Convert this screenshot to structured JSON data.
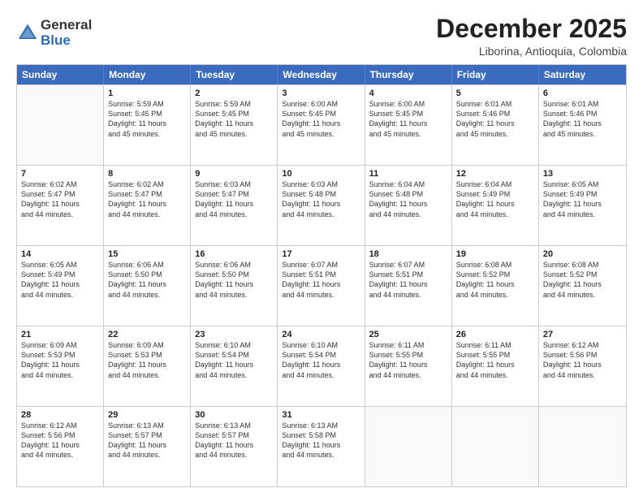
{
  "logo": {
    "general": "General",
    "blue": "Blue"
  },
  "title": "December 2025",
  "location": "Liborina, Antioquia, Colombia",
  "header_days": [
    "Sunday",
    "Monday",
    "Tuesday",
    "Wednesday",
    "Thursday",
    "Friday",
    "Saturday"
  ],
  "weeks": [
    [
      {
        "day": "",
        "info": ""
      },
      {
        "day": "1",
        "info": "Sunrise: 5:59 AM\nSunset: 5:45 PM\nDaylight: 11 hours\nand 45 minutes."
      },
      {
        "day": "2",
        "info": "Sunrise: 5:59 AM\nSunset: 5:45 PM\nDaylight: 11 hours\nand 45 minutes."
      },
      {
        "day": "3",
        "info": "Sunrise: 6:00 AM\nSunset: 5:45 PM\nDaylight: 11 hours\nand 45 minutes."
      },
      {
        "day": "4",
        "info": "Sunrise: 6:00 AM\nSunset: 5:45 PM\nDaylight: 11 hours\nand 45 minutes."
      },
      {
        "day": "5",
        "info": "Sunrise: 6:01 AM\nSunset: 5:46 PM\nDaylight: 11 hours\nand 45 minutes."
      },
      {
        "day": "6",
        "info": "Sunrise: 6:01 AM\nSunset: 5:46 PM\nDaylight: 11 hours\nand 45 minutes."
      }
    ],
    [
      {
        "day": "7",
        "info": "Sunrise: 6:02 AM\nSunset: 5:47 PM\nDaylight: 11 hours\nand 44 minutes."
      },
      {
        "day": "8",
        "info": "Sunrise: 6:02 AM\nSunset: 5:47 PM\nDaylight: 11 hours\nand 44 minutes."
      },
      {
        "day": "9",
        "info": "Sunrise: 6:03 AM\nSunset: 5:47 PM\nDaylight: 11 hours\nand 44 minutes."
      },
      {
        "day": "10",
        "info": "Sunrise: 6:03 AM\nSunset: 5:48 PM\nDaylight: 11 hours\nand 44 minutes."
      },
      {
        "day": "11",
        "info": "Sunrise: 6:04 AM\nSunset: 5:48 PM\nDaylight: 11 hours\nand 44 minutes."
      },
      {
        "day": "12",
        "info": "Sunrise: 6:04 AM\nSunset: 5:49 PM\nDaylight: 11 hours\nand 44 minutes."
      },
      {
        "day": "13",
        "info": "Sunrise: 6:05 AM\nSunset: 5:49 PM\nDaylight: 11 hours\nand 44 minutes."
      }
    ],
    [
      {
        "day": "14",
        "info": "Sunrise: 6:05 AM\nSunset: 5:49 PM\nDaylight: 11 hours\nand 44 minutes."
      },
      {
        "day": "15",
        "info": "Sunrise: 6:06 AM\nSunset: 5:50 PM\nDaylight: 11 hours\nand 44 minutes."
      },
      {
        "day": "16",
        "info": "Sunrise: 6:06 AM\nSunset: 5:50 PM\nDaylight: 11 hours\nand 44 minutes."
      },
      {
        "day": "17",
        "info": "Sunrise: 6:07 AM\nSunset: 5:51 PM\nDaylight: 11 hours\nand 44 minutes."
      },
      {
        "day": "18",
        "info": "Sunrise: 6:07 AM\nSunset: 5:51 PM\nDaylight: 11 hours\nand 44 minutes."
      },
      {
        "day": "19",
        "info": "Sunrise: 6:08 AM\nSunset: 5:52 PM\nDaylight: 11 hours\nand 44 minutes."
      },
      {
        "day": "20",
        "info": "Sunrise: 6:08 AM\nSunset: 5:52 PM\nDaylight: 11 hours\nand 44 minutes."
      }
    ],
    [
      {
        "day": "21",
        "info": "Sunrise: 6:09 AM\nSunset: 5:53 PM\nDaylight: 11 hours\nand 44 minutes."
      },
      {
        "day": "22",
        "info": "Sunrise: 6:09 AM\nSunset: 5:53 PM\nDaylight: 11 hours\nand 44 minutes."
      },
      {
        "day": "23",
        "info": "Sunrise: 6:10 AM\nSunset: 5:54 PM\nDaylight: 11 hours\nand 44 minutes."
      },
      {
        "day": "24",
        "info": "Sunrise: 6:10 AM\nSunset: 5:54 PM\nDaylight: 11 hours\nand 44 minutes."
      },
      {
        "day": "25",
        "info": "Sunrise: 6:11 AM\nSunset: 5:55 PM\nDaylight: 11 hours\nand 44 minutes."
      },
      {
        "day": "26",
        "info": "Sunrise: 6:11 AM\nSunset: 5:55 PM\nDaylight: 11 hours\nand 44 minutes."
      },
      {
        "day": "27",
        "info": "Sunrise: 6:12 AM\nSunset: 5:56 PM\nDaylight: 11 hours\nand 44 minutes."
      }
    ],
    [
      {
        "day": "28",
        "info": "Sunrise: 6:12 AM\nSunset: 5:56 PM\nDaylight: 11 hours\nand 44 minutes."
      },
      {
        "day": "29",
        "info": "Sunrise: 6:13 AM\nSunset: 5:57 PM\nDaylight: 11 hours\nand 44 minutes."
      },
      {
        "day": "30",
        "info": "Sunrise: 6:13 AM\nSunset: 5:57 PM\nDaylight: 11 hours\nand 44 minutes."
      },
      {
        "day": "31",
        "info": "Sunrise: 6:13 AM\nSunset: 5:58 PM\nDaylight: 11 hours\nand 44 minutes."
      },
      {
        "day": "",
        "info": ""
      },
      {
        "day": "",
        "info": ""
      },
      {
        "day": "",
        "info": ""
      }
    ]
  ]
}
